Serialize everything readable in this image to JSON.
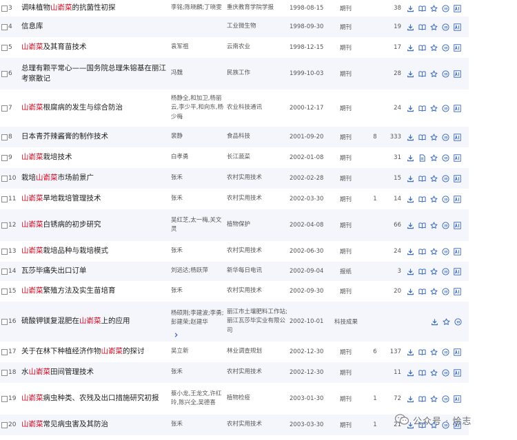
{
  "results": [
    {
      "num": "3",
      "title_parts": [
        {
          "t": "调味植物"
        },
        {
          "t": "山嵛菜",
          "hl": true
        },
        {
          "t": "的抗菌性初探"
        }
      ],
      "authors": "李铭;陈晓麟;丁晓雯",
      "source": "重庆教育学院学报",
      "date": "1998-08-15",
      "type": "期刊",
      "cited": "",
      "downloads": "38",
      "ops": [
        "download",
        "read",
        "favorite",
        "quote",
        "ai"
      ]
    },
    {
      "num": "4",
      "title_parts": [
        {
          "t": "信息库"
        }
      ],
      "authors": "",
      "source": "工业微生物",
      "date": "1998-09-30",
      "type": "期刊",
      "cited": "",
      "downloads": "19",
      "ops": [
        "download",
        "read",
        "favorite",
        "quote",
        "ai"
      ]
    },
    {
      "num": "5",
      "title_parts": [
        {
          "t": "山嵛菜",
          "hl": true
        },
        {
          "t": "及其育苗技术"
        }
      ],
      "authors": "袁军祖",
      "source": "云南农业",
      "date": "1998-12-15",
      "type": "期刊",
      "cited": "",
      "downloads": "17",
      "ops": [
        "download",
        "read",
        "favorite",
        "quote",
        "ai"
      ]
    },
    {
      "num": "6",
      "title_parts": [
        {
          "t": "总理有颗平常心——国务院总理朱镕基在丽江考察散记"
        }
      ],
      "authors": "冯魏",
      "source": "民族工作",
      "date": "1999-10-03",
      "type": "期刊",
      "cited": "",
      "downloads": "28",
      "ops": [
        "download",
        "read",
        "favorite",
        "quote",
        "ai"
      ]
    },
    {
      "num": "7",
      "title_parts": [
        {
          "t": "山嵛菜",
          "hl": true
        },
        {
          "t": "根腐病的发生与综合防治"
        }
      ],
      "authors": "杨静全,和加卫,杨丽云,李少平,和向东,杨少梅",
      "source": "农业科技通讯",
      "date": "2000-12-17",
      "type": "期刊",
      "cited": "",
      "downloads": "24",
      "ops": [
        "download",
        "read",
        "favorite",
        "quote",
        "ai"
      ]
    },
    {
      "num": "8",
      "title_parts": [
        {
          "t": "日本青芥辣酱膏的制作技术"
        }
      ],
      "authors": "裴静",
      "source": "食品科技",
      "date": "2001-09-20",
      "type": "期刊",
      "cited": "8",
      "downloads": "333",
      "ops": [
        "download",
        "read",
        "favorite",
        "quote",
        "ai"
      ]
    },
    {
      "num": "9",
      "title_parts": [
        {
          "t": "山嵛菜",
          "hl": true
        },
        {
          "t": "栽培技术"
        }
      ],
      "authors": "白孝勇",
      "source": "长江蔬菜",
      "date": "2002-01-08",
      "type": "期刊",
      "cited": "",
      "downloads": "31",
      "ops": [
        "download",
        "pdf",
        "favorite",
        "quote",
        "ai"
      ]
    },
    {
      "num": "10",
      "title_parts": [
        {
          "t": "栽培"
        },
        {
          "t": "山嵛菜",
          "hl": true
        },
        {
          "t": "市场前景广"
        }
      ],
      "authors": "张禾",
      "source": "农村实用技术",
      "date": "2002-02-28",
      "type": "期刊",
      "cited": "",
      "downloads": "15",
      "ops": [
        "download",
        "read",
        "favorite",
        "quote",
        "ai"
      ]
    },
    {
      "num": "11",
      "title_parts": [
        {
          "t": "山嵛菜",
          "hl": true
        },
        {
          "t": "旱地栽培管理技术"
        }
      ],
      "authors": "张禾",
      "source": "农村实用技术",
      "date": "2002-03-30",
      "type": "期刊",
      "cited": "1",
      "downloads": "14",
      "ops": [
        "download",
        "read",
        "favorite",
        "quote",
        "ai"
      ]
    },
    {
      "num": "12",
      "title_parts": [
        {
          "t": "山嵛菜",
          "hl": true
        },
        {
          "t": "白锈病的初步研究"
        }
      ],
      "authors": "吴红芝,太一梅,关文灵",
      "source": "植物保护",
      "date": "2002-04-08",
      "type": "期刊",
      "cited": "",
      "downloads": "66",
      "ops": [
        "download",
        "read",
        "favorite",
        "quote",
        "ai"
      ]
    },
    {
      "num": "13",
      "title_parts": [
        {
          "t": "山嵛菜",
          "hl": true
        },
        {
          "t": "栽培品种与栽培模式"
        }
      ],
      "authors": "张禾",
      "source": "农村实用技术",
      "date": "2002-06-30",
      "type": "期刊",
      "cited": "",
      "downloads": "24",
      "ops": [
        "download",
        "read",
        "favorite",
        "quote",
        "ai"
      ]
    },
    {
      "num": "14",
      "title_parts": [
        {
          "t": "瓦莎毕痛失出口订单"
        }
      ],
      "authors": "刘远达;杨跃萍",
      "source": "新华每日电讯",
      "date": "2002-09-04",
      "type": "报纸",
      "cited": "",
      "downloads": "3",
      "ops": [
        "download",
        "read",
        "favorite",
        "quote",
        "ai"
      ]
    },
    {
      "num": "15",
      "title_parts": [
        {
          "t": "山嵛菜",
          "hl": true
        },
        {
          "t": "繁殖方法及实生苗培育"
        }
      ],
      "authors": "张禾",
      "source": "农村实用技术",
      "date": "2002-09-30",
      "type": "期刊",
      "cited": "",
      "downloads": "20",
      "ops": [
        "download",
        "read",
        "favorite",
        "quote",
        "ai"
      ]
    },
    {
      "num": "16",
      "title_parts": [
        {
          "t": "硫酸钾镁复混肥在"
        },
        {
          "t": "山嵛菜",
          "hl": true
        },
        {
          "t": "上的应用"
        }
      ],
      "authors": "杨硕刚;李建波;李勇;彭建荣;赵建华",
      "source": "丽江市土壤肥料工作站;丽江瓦莎毕实业有限公司",
      "date": "2002-10-01",
      "type": "科技成果",
      "cited": "",
      "downloads": "",
      "ops": [
        "download",
        "favorite",
        "quote"
      ],
      "more_authors": true
    },
    {
      "num": "17",
      "title_parts": [
        {
          "t": "关于在林下种植经济作物"
        },
        {
          "t": "山嵛菜",
          "hl": true
        },
        {
          "t": "的探讨"
        }
      ],
      "authors": "吴立新",
      "source": "林业调查规划",
      "date": "2002-12-30",
      "type": "期刊",
      "cited": "6",
      "downloads": "137",
      "ops": [
        "download",
        "read",
        "favorite",
        "quote",
        "ai"
      ]
    },
    {
      "num": "18",
      "title_parts": [
        {
          "t": "水"
        },
        {
          "t": "山嵛菜",
          "hl": true
        },
        {
          "t": "田间管理技术"
        }
      ],
      "authors": "张禾",
      "source": "农村实用技术",
      "date": "2002-12-30",
      "type": "期刊",
      "cited": "",
      "downloads": "11",
      "ops": [
        "download",
        "read",
        "favorite",
        "quote",
        "ai"
      ]
    },
    {
      "num": "19",
      "title_parts": [
        {
          "t": "山嵛菜",
          "hl": true
        },
        {
          "t": "病虫种类、农残及出口措施研究初报"
        }
      ],
      "authors": "蔡小龙,王龙文,许红玲,陈兴全,吴德喜",
      "source": "植物检疫",
      "date": "2003-01-30",
      "type": "期刊",
      "cited": "1",
      "downloads": "72",
      "ops": [
        "download",
        "read",
        "favorite",
        "quote",
        "ai"
      ]
    },
    {
      "num": "20",
      "title_parts": [
        {
          "t": "山嵛菜",
          "hl": true
        },
        {
          "t": "常见病虫害及其防治"
        }
      ],
      "authors": "张禾",
      "source": "农村实用技术",
      "date": "2003-03-30",
      "type": "期刊",
      "cited": "1",
      "downloads": "21",
      "ops": [
        "download",
        "read",
        "favorite",
        "quote",
        "ai"
      ]
    }
  ],
  "watermark": {
    "text": "公众号 · 烩志"
  },
  "colors": {
    "keyword": "#d0021b",
    "icon": "#3c6cc0",
    "row_alt": "#f4f6fb"
  }
}
